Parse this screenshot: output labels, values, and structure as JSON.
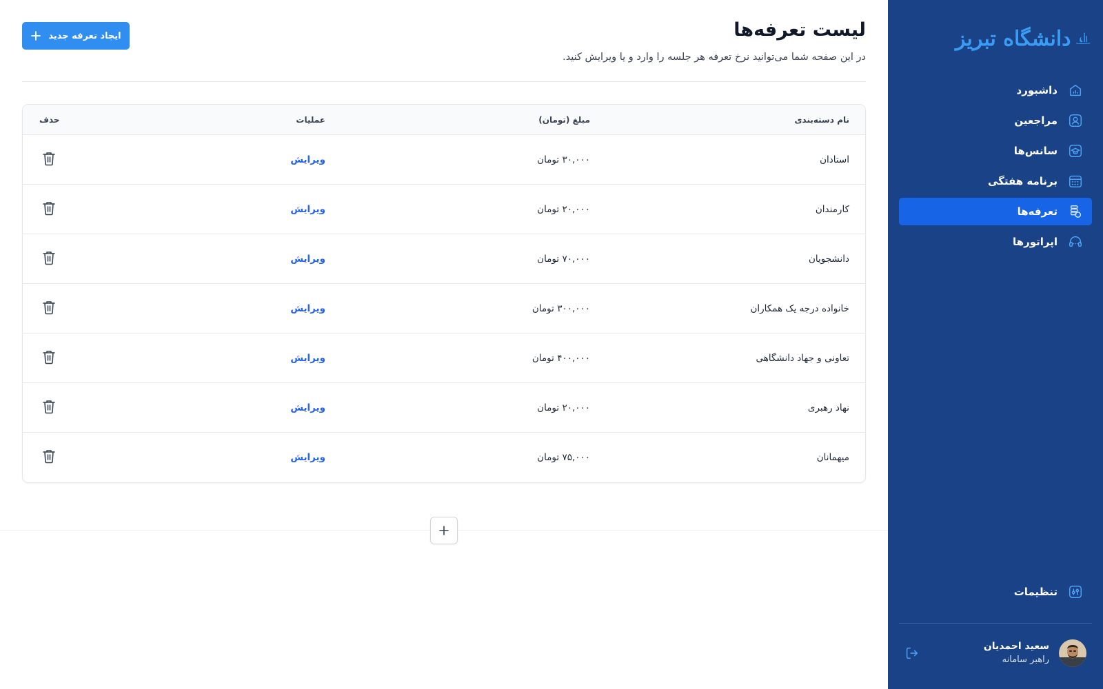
{
  "sidebar": {
    "logo_text": "دانشگاه تبریز",
    "nav": [
      {
        "label": "داشبورد",
        "icon": "home-icon",
        "active": false
      },
      {
        "label": "مراجعین",
        "icon": "user-icon",
        "active": false
      },
      {
        "label": "سانس‌ها",
        "icon": "graduation-cap-icon",
        "active": false
      },
      {
        "label": "برنامه هفتگی",
        "icon": "calendar-icon",
        "active": false
      },
      {
        "label": "تعرفه‌ها",
        "icon": "coins-icon",
        "active": true
      },
      {
        "label": "اپراتورها",
        "icon": "headset-icon",
        "active": false
      }
    ],
    "settings_label": "تنظیمات",
    "user": {
      "name": "سعید احمدیان",
      "role": "راهبر سامانه"
    }
  },
  "header": {
    "title": "لیست تعرفه‌ها",
    "subtitle": "در این صفحه شما می‌توانید نرخ تعرفه هر جلسه را وارد و یا ویرایش کنید.",
    "create_button_label": "ایجاد تعرفه جدید"
  },
  "table": {
    "columns": {
      "name": "نام دسته‌بندی",
      "price": "مبلغ (تومان)",
      "operations": "عملیات",
      "delete": "حذف"
    },
    "edit_label": "ویرایش",
    "rows": [
      {
        "name": "استادان",
        "price": "۳۰,۰۰۰ تومان"
      },
      {
        "name": "کارمندان",
        "price": "۲۰,۰۰۰ تومان"
      },
      {
        "name": "دانشجویان",
        "price": "۷۰,۰۰۰ تومان"
      },
      {
        "name": "خانواده درجه یک همکاران",
        "price": "۳۰۰,۰۰۰ تومان"
      },
      {
        "name": "تعاونی و جهاد دانشگاهی",
        "price": "۴۰۰,۰۰۰ تومان"
      },
      {
        "name": "نهاد رهبری",
        "price": "۲۰,۰۰۰ تومان"
      },
      {
        "name": "میهمانان",
        "price": "۷۵,۰۰۰ تومان"
      }
    ]
  },
  "colors": {
    "sidebar_bg": "#1a4286",
    "active_nav": "#1864e6",
    "accent": "#2f8ef0",
    "link": "#2563eb"
  }
}
